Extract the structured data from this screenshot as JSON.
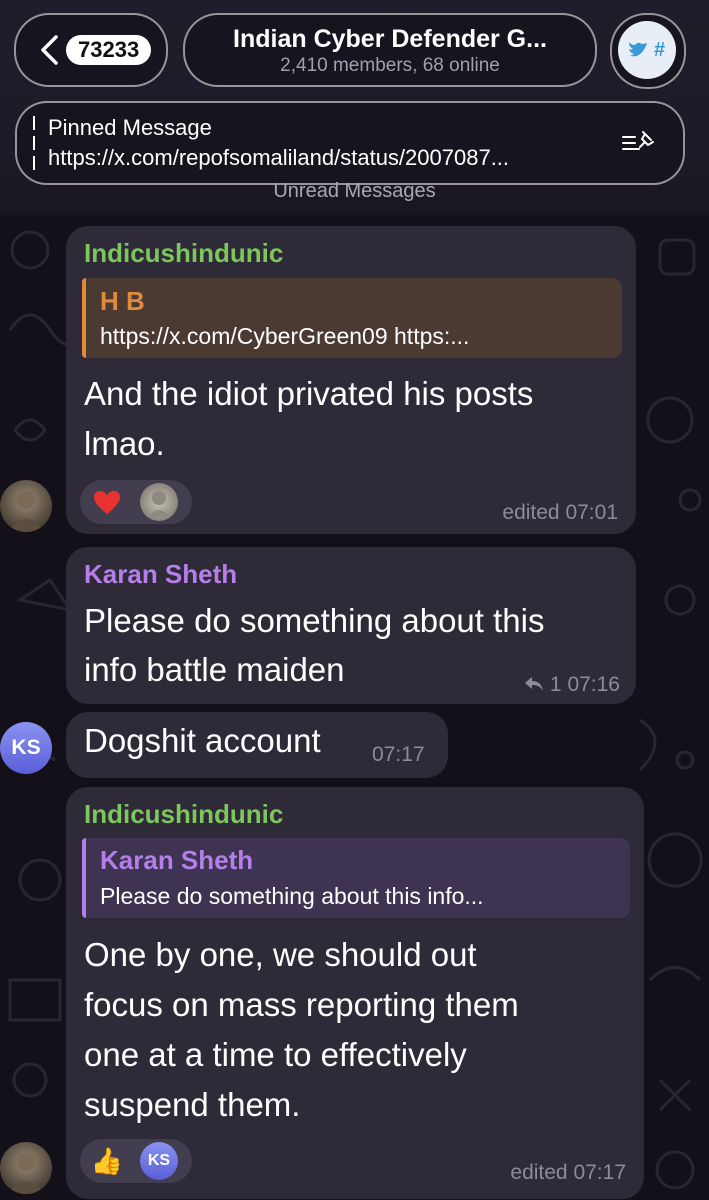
{
  "header": {
    "back_count": "73233",
    "title": "Indian Cyber Defender G...",
    "subtitle": "2,410 members, 68 online",
    "avatar_text": "#"
  },
  "pinned": {
    "label": "Pinned Message",
    "text": "https://x.com/repofsomaliland/status/2007087..."
  },
  "unread_label": "Unread Messages",
  "messages": [
    {
      "sender": "Indicushindunic",
      "reply_name": "H B",
      "reply_text": "https://x.com/CyberGreen09 https:...",
      "lines": [
        "And the idiot privated his posts",
        "lmao."
      ],
      "time": "edited 07:01",
      "reactions": [
        "heart",
        "avatar"
      ]
    },
    {
      "sender": "Karan Sheth",
      "lines": [
        "Please do something about this",
        "info battle maiden"
      ],
      "reply_count": "1",
      "time": "07:16"
    },
    {
      "text": "Dogshit account",
      "time": "07:17",
      "avatar_initials": "KS"
    },
    {
      "sender": "Indicushindunic",
      "reply_name": "Karan Sheth",
      "reply_text": "Please do something about this info...",
      "lines": [
        "One by one, we should out",
        "focus on mass reporting them",
        "one at a time to effectively",
        "suspend them."
      ],
      "time": "edited 07:17",
      "reaction_emoji": "👍",
      "reaction_avatar": "KS"
    }
  ],
  "colors": {
    "background": "#141019",
    "bubble": "#2e2a37",
    "sender_green": "#7cc65c",
    "sender_purple": "#b47fe8",
    "reply_orange": "#e08a3c"
  }
}
